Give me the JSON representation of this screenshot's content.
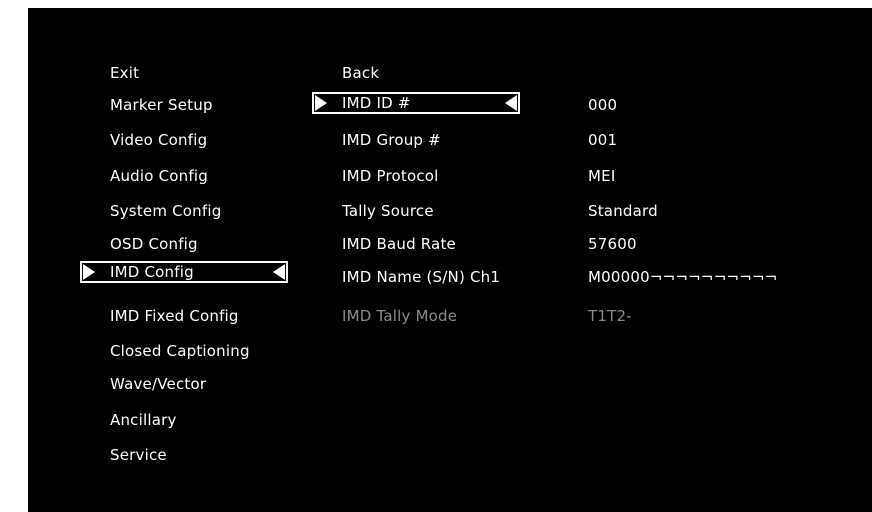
{
  "left_menu": {
    "items": [
      {
        "label": "Exit"
      },
      {
        "label": "Marker Setup"
      },
      {
        "label": "Video Config"
      },
      {
        "label": "Audio Config"
      },
      {
        "label": "System Config"
      },
      {
        "label": "OSD Config"
      },
      {
        "label": "IMD Config",
        "selected": true
      },
      {
        "label": "IMD Fixed Config"
      },
      {
        "label": "Closed Captioning"
      },
      {
        "label": "Wave/Vector"
      },
      {
        "label": "Ancillary"
      },
      {
        "label": "Service"
      }
    ]
  },
  "sub_menu": {
    "back_label": "Back",
    "items": [
      {
        "label": "IMD ID #",
        "value": "000",
        "selected": true
      },
      {
        "label": "IMD Group #",
        "value": "001"
      },
      {
        "label": "IMD Protocol",
        "value": "MEI"
      },
      {
        "label": "Tally Source",
        "value": "Standard"
      },
      {
        "label": "IMD Baud Rate",
        "value": "57600"
      },
      {
        "label": "IMD Name (S/N) Ch1",
        "value": "M00000¬¬¬¬¬¬¬¬¬¬"
      },
      {
        "label": "IMD Tally Mode",
        "value": "T1T2-",
        "disabled": true
      }
    ]
  },
  "colors": {
    "background": "#000000",
    "text": "#ffffff",
    "disabled_text": "#8a8a8a",
    "selection_border": "#ffffff"
  }
}
